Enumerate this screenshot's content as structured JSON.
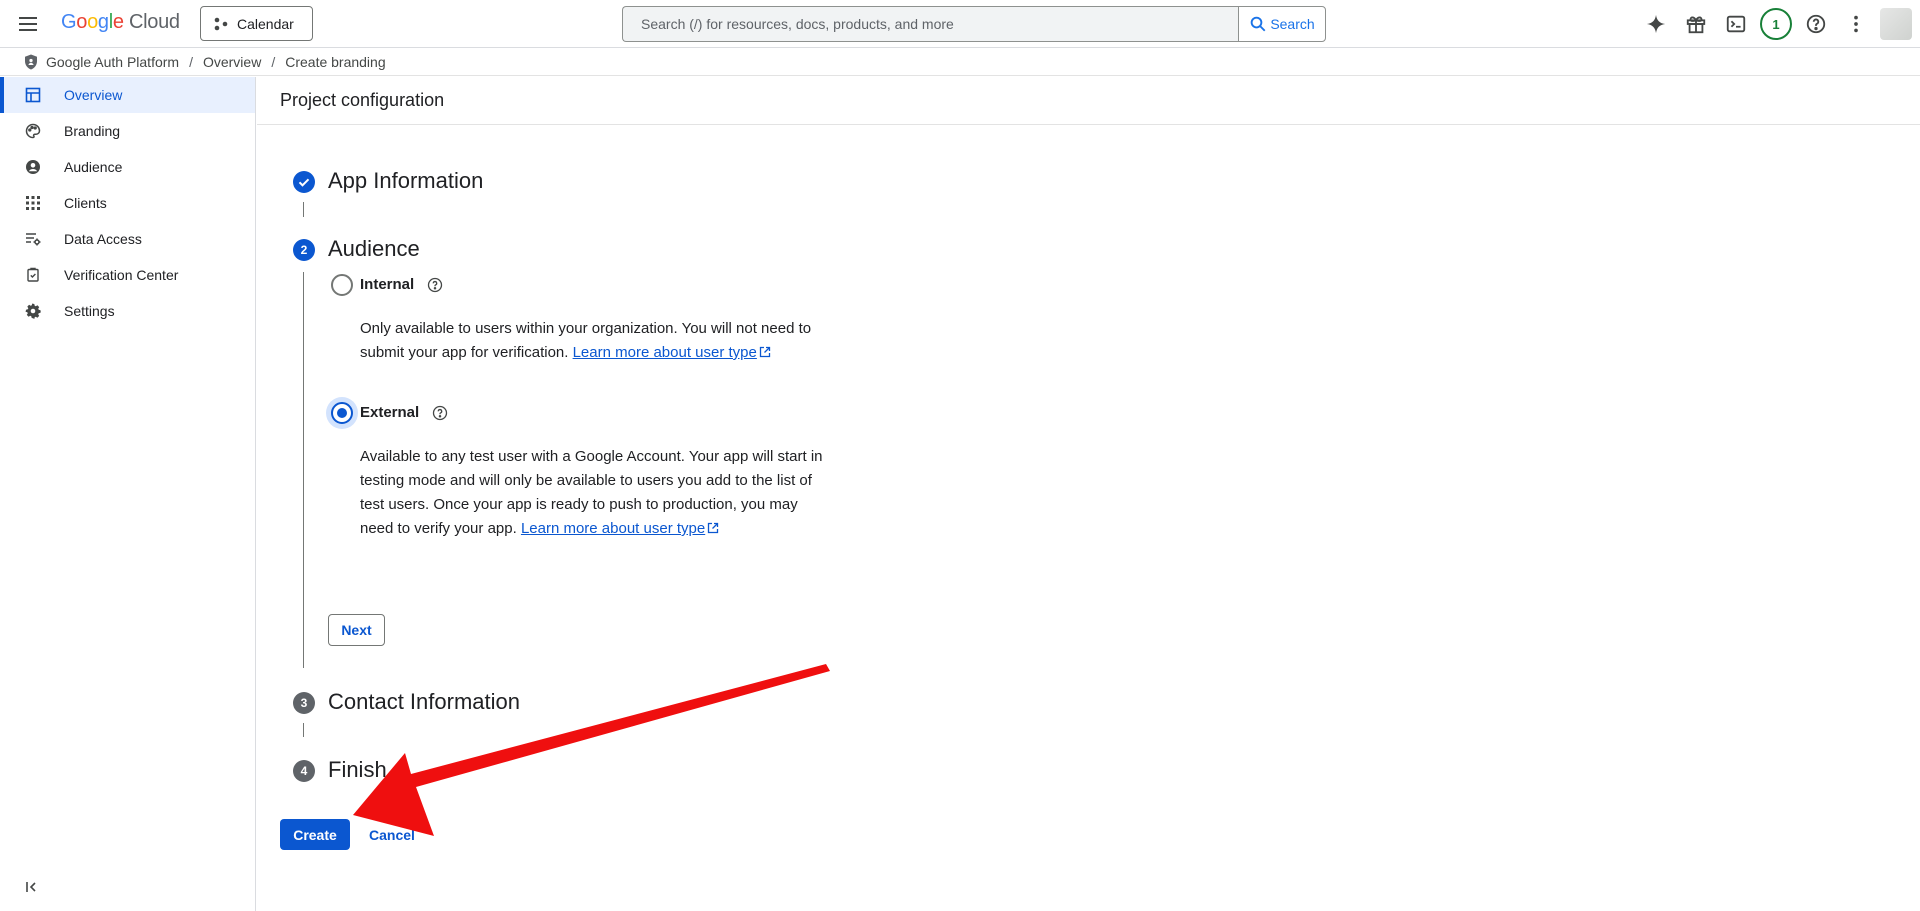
{
  "topbar": {
    "logo": {
      "part1": "G",
      "part2": "o",
      "part3": "o",
      "part4": "g",
      "part5": "l",
      "part6": "e",
      "cloud": "Cloud"
    },
    "project_label": "Calendar",
    "search_placeholder": "Search (/) for resources, docs, products, and more",
    "search_button": "Search",
    "notifications_count": "1"
  },
  "breadcrumb": [
    "Google Auth Platform",
    "Overview",
    "Create branding"
  ],
  "sidebar": {
    "items": [
      {
        "label": "Overview",
        "icon": "dashboard-icon",
        "active": true
      },
      {
        "label": "Branding",
        "icon": "palette-icon"
      },
      {
        "label": "Audience",
        "icon": "account-circle-icon"
      },
      {
        "label": "Clients",
        "icon": "apps-grid-icon"
      },
      {
        "label": "Data Access",
        "icon": "data-access-icon"
      },
      {
        "label": "Verification Center",
        "icon": "verification-icon"
      },
      {
        "label": "Settings",
        "icon": "gear-icon"
      }
    ],
    "collapse_icon": "collapse-icon"
  },
  "main": {
    "header": "Project configuration",
    "steps": [
      {
        "number": "✓",
        "title": "App Information",
        "state": "done"
      },
      {
        "number": "2",
        "title": "Audience",
        "state": "active"
      },
      {
        "number": "3",
        "title": "Contact Information",
        "state": "pending"
      },
      {
        "number": "4",
        "title": "Finish",
        "state": "pending"
      }
    ],
    "audience": {
      "options": [
        {
          "label": "Internal",
          "checked": false,
          "desc_text": "Only available to users within your organization. You will not need to submit your app for verification. ",
          "link_text": "Learn more about user type"
        },
        {
          "label": "External",
          "checked": true,
          "desc_text": "Available to any test user with a Google Account. Your app will start in testing mode and will only be available to users you add to the list of test users. Once your app is ready to push to production, you may need to verify your app. ",
          "link_text": "Learn more about user type"
        }
      ],
      "next_button": "Next"
    },
    "create_button": "Create",
    "cancel_button": "Cancel"
  },
  "colors": {
    "primary": "#0b57d0",
    "annotation_arrow": "#ef0f0f",
    "notification": "#188038"
  }
}
